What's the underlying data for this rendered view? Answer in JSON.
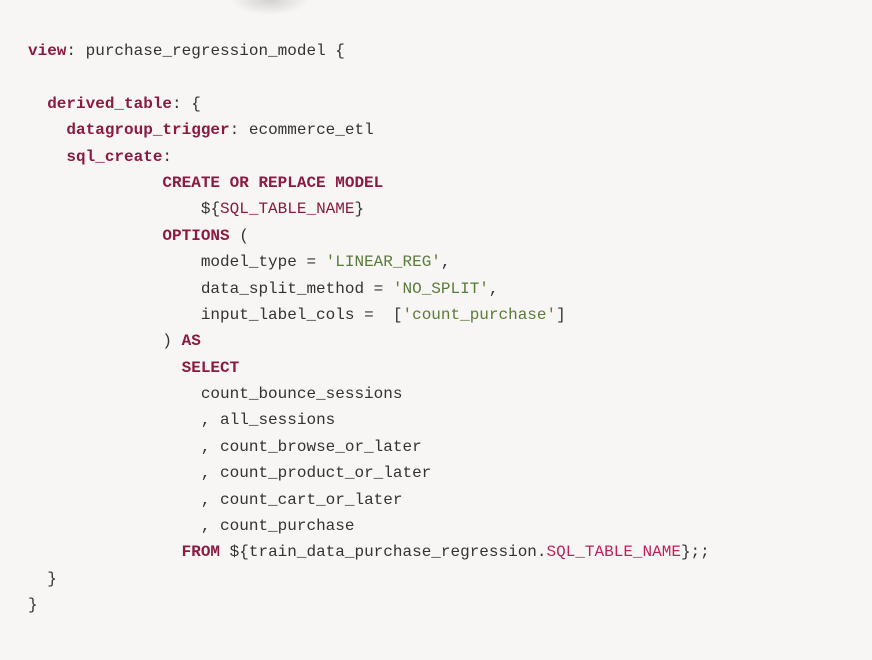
{
  "code": {
    "kw_view": "view",
    "view_name": "purchase_regression_model",
    "kw_derived_table": "derived_table",
    "kw_datagroup_trigger": "datagroup_trigger",
    "datagroup_value": "ecommerce_etl",
    "kw_sql_create": "sql_create",
    "sql_create_or_replace": "CREATE OR REPLACE MODEL",
    "sql_table_name": "SQL_TABLE_NAME",
    "sql_options": "OPTIONS",
    "opt_model_type_key": "model_type",
    "opt_model_type_val": "'LINEAR_REG'",
    "opt_data_split_key": "data_split_method",
    "opt_data_split_val": "'NO_SPLIT'",
    "opt_input_label_key": "input_label_cols",
    "opt_input_label_val": "'count_purchase'",
    "sql_as": "AS",
    "sql_select": "SELECT",
    "col1": "count_bounce_sessions",
    "col2": "all_sessions",
    "col3": "count_browse_or_later",
    "col4": "count_product_or_later",
    "col5": "count_cart_or_later",
    "col6": "count_purchase",
    "sql_from": "FROM",
    "from_table": "train_data_purchase_regression",
    "from_table_suffix": "SQL_TABLE_NAME"
  }
}
